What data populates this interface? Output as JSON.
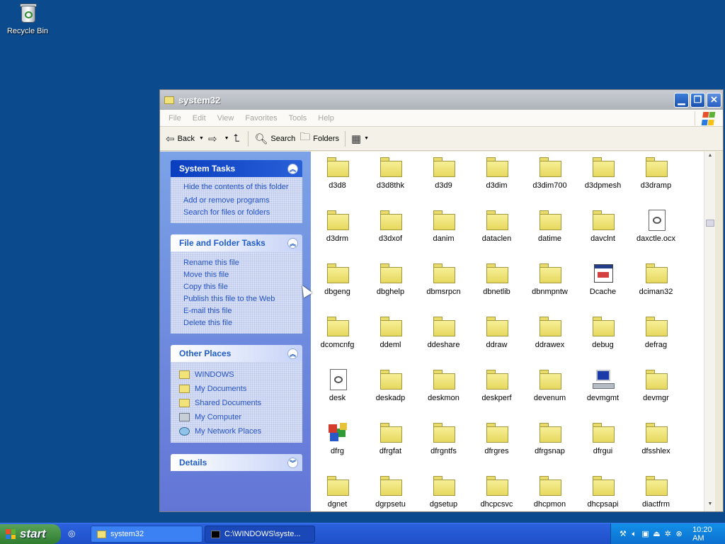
{
  "desktop": {
    "recycle_bin": "Recycle Bin"
  },
  "window": {
    "title": "system32",
    "menu": [
      "File",
      "Edit",
      "View",
      "Favorites",
      "Tools",
      "Help"
    ],
    "toolbar": {
      "back": "Back",
      "forward": "",
      "search": "Search",
      "folders": "Folders"
    }
  },
  "taskpane": {
    "system_tasks": {
      "title": "System Tasks",
      "links": [
        "Hide the contents of this folder",
        "Add or remove programs",
        "Search for files or folders"
      ]
    },
    "file_folder_tasks": {
      "title": "File and Folder Tasks",
      "links": [
        "Rename this file",
        "Move this file",
        "Copy this file",
        "Publish this file to the Web",
        "E-mail this file",
        "Delete this file"
      ]
    },
    "other_places": {
      "title": "Other Places",
      "links": [
        "WINDOWS",
        "My Documents",
        "Shared Documents",
        "My Computer",
        "My Network Places"
      ]
    },
    "details": {
      "title": "Details"
    }
  },
  "files": [
    [
      "d3d8",
      "d3d8thk",
      "d3d9",
      "d3dim",
      "d3dim700",
      "d3dpmesh",
      "d3dramp"
    ],
    [
      "d3drm",
      "d3dxof",
      "danim",
      "dataclen",
      "datime",
      "davclnt",
      "daxctle.ocx"
    ],
    [
      "dbgeng",
      "dbghelp",
      "dbmsrpcn",
      "dbnetlib",
      "dbnmpntw",
      "Dcache",
      "dciman32"
    ],
    [
      "dcomcnfg",
      "ddeml",
      "ddeshare",
      "ddraw",
      "ddrawex",
      "debug",
      "defrag"
    ],
    [
      "desk",
      "deskadp",
      "deskmon",
      "deskperf",
      "devenum",
      "devmgmt",
      "devmgr"
    ],
    [
      "dfrg",
      "dfrgfat",
      "dfrgntfs",
      "dfrgres",
      "dfrgsnap",
      "dfrgui",
      "dfsshlex"
    ],
    [
      "dgnet",
      "dgrpsetu",
      "dgsetup",
      "dhcpcsvc",
      "dhcpmon",
      "dhcpsapi",
      "diactfrm"
    ]
  ],
  "special_icons": {
    "daxctle.ocx": "doc",
    "Dcache": "app",
    "desk": "doc",
    "devmgmt": "pc",
    "dfrg": "dfrg"
  },
  "taskbar": {
    "start": "start",
    "tasks": [
      "system32",
      "C:\\WINDOWS\\syste..."
    ],
    "clock": "10:20 AM"
  }
}
